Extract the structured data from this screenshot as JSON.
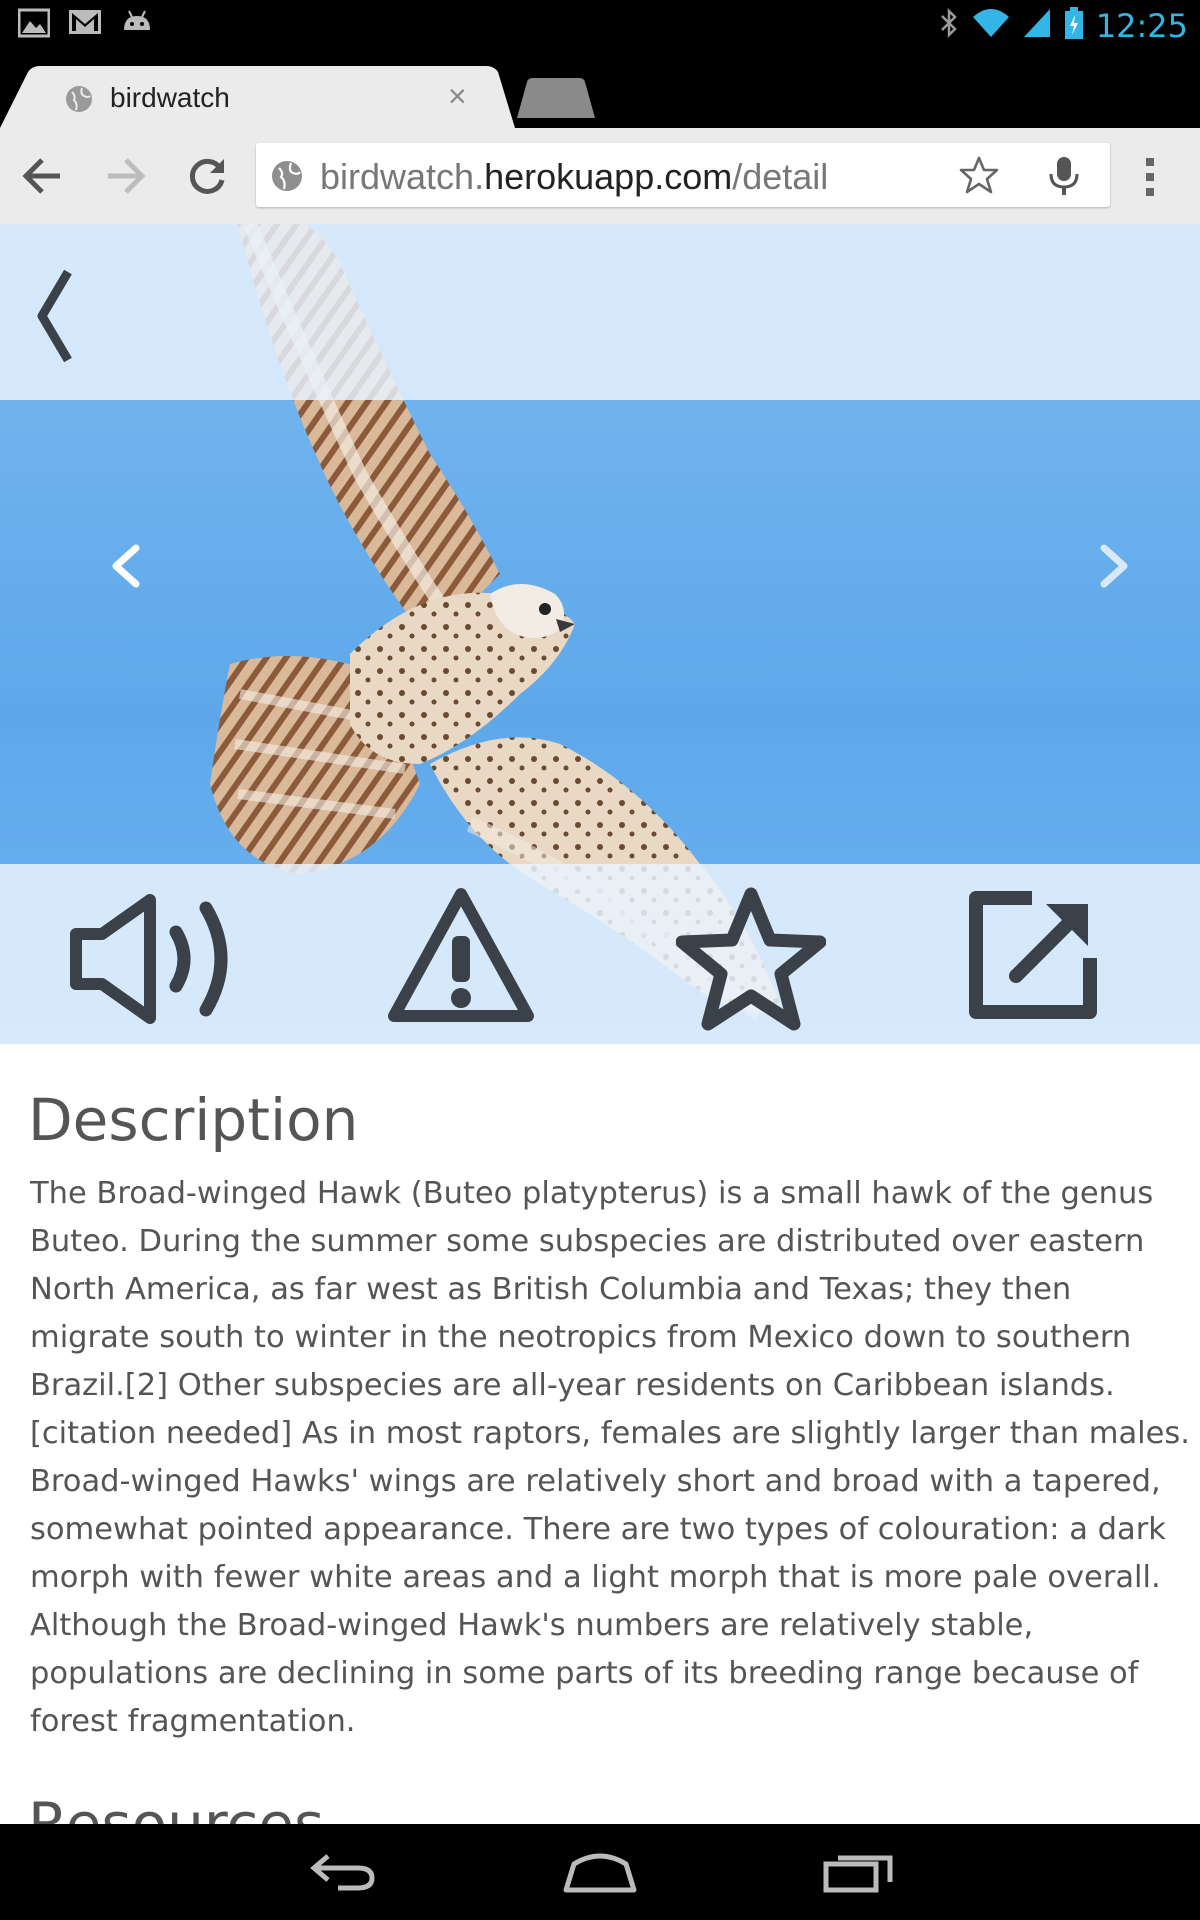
{
  "status_bar": {
    "time": "12:25",
    "left_icons": [
      "gallery-icon",
      "gmail-icon",
      "android-icon"
    ],
    "right_icons": [
      "bluetooth-icon",
      "wifi-icon",
      "signal-icon",
      "battery-charging-icon"
    ]
  },
  "tab": {
    "title": "birdwatch",
    "close": "×"
  },
  "omnibox": {
    "url_scheme_part": "birdwatch.",
    "url_host": "herokuapp.com",
    "url_path": "/detail"
  },
  "hero": {
    "actions": [
      "sound-icon",
      "alert-icon",
      "favorite-star-icon",
      "external-link-icon"
    ]
  },
  "content": {
    "description_heading": "Description",
    "description_text": "The Broad-winged Hawk (Buteo platypterus) is a small hawk of the genus Buteo. During the summer some subspecies are distributed over eastern North America, as far west as British Columbia and Texas; they then migrate south to winter in the neotropics from Mexico down to southern Brazil.[2] Other subspecies are all-year residents on Caribbean islands.[citation needed] As in most raptors, females are slightly larger than males. Broad-winged Hawks' wings are relatively short and broad with a tapered, somewhat pointed appearance. There are two types of colouration: a dark morph with fewer white areas and a light morph that is more pale overall. Although the Broad-winged Hawk's numbers are relatively stable, populations are declining in some parts of its breeding range because of forest fragmentation.",
    "resources_heading": "Resources"
  },
  "colors": {
    "status_accent": "#33b5e5",
    "sky": "#6eb2ef",
    "icon_dark": "#3a4148",
    "text": "#555555"
  }
}
